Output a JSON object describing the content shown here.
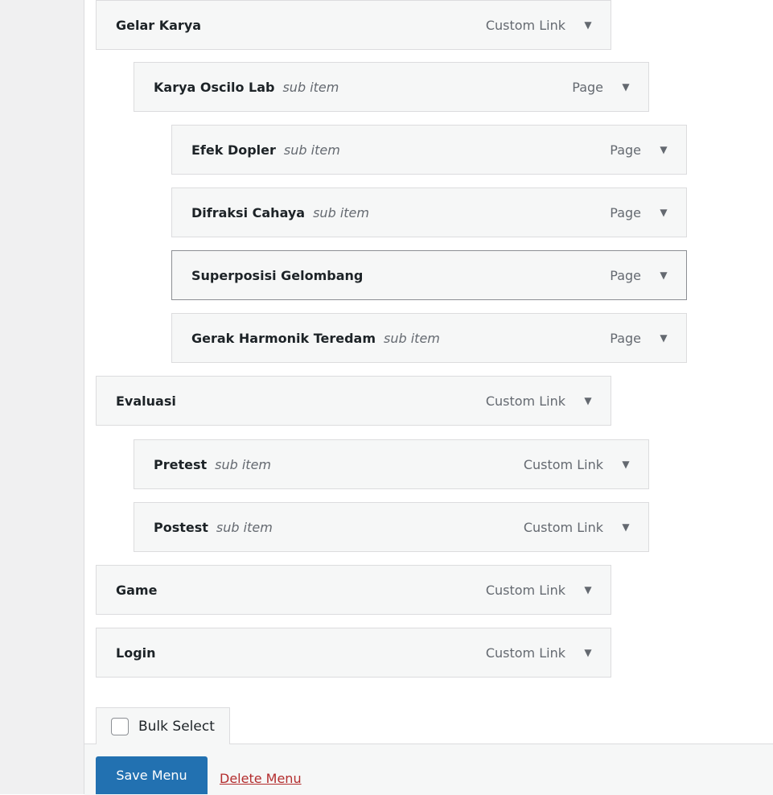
{
  "menu_items": [
    {
      "title": "Gelar Karya",
      "sub": "",
      "type": "Custom Link"
    },
    {
      "title": "Karya Oscilo Lab",
      "sub": "sub item",
      "type": "Page"
    },
    {
      "title": "Efek Dopler",
      "sub": "sub item",
      "type": "Page"
    },
    {
      "title": "Difraksi Cahaya",
      "sub": "sub item",
      "type": "Page"
    },
    {
      "title": "Superposisi Gelombang",
      "sub": "",
      "type": "Page"
    },
    {
      "title": "Gerak Harmonik Teredam",
      "sub": "sub item",
      "type": "Page"
    },
    {
      "title": "Evaluasi",
      "sub": "",
      "type": "Custom Link"
    },
    {
      "title": "Pretest",
      "sub": "sub item",
      "type": "Custom Link"
    },
    {
      "title": "Postest",
      "sub": "sub item",
      "type": "Custom Link"
    },
    {
      "title": "Game",
      "sub": "",
      "type": "Custom Link"
    },
    {
      "title": "Login",
      "sub": "",
      "type": "Custom Link"
    }
  ],
  "bulk_select": {
    "label": "Bulk Select",
    "checked": false
  },
  "actions": {
    "save_label": "Save Menu",
    "delete_label": "Delete Menu"
  }
}
